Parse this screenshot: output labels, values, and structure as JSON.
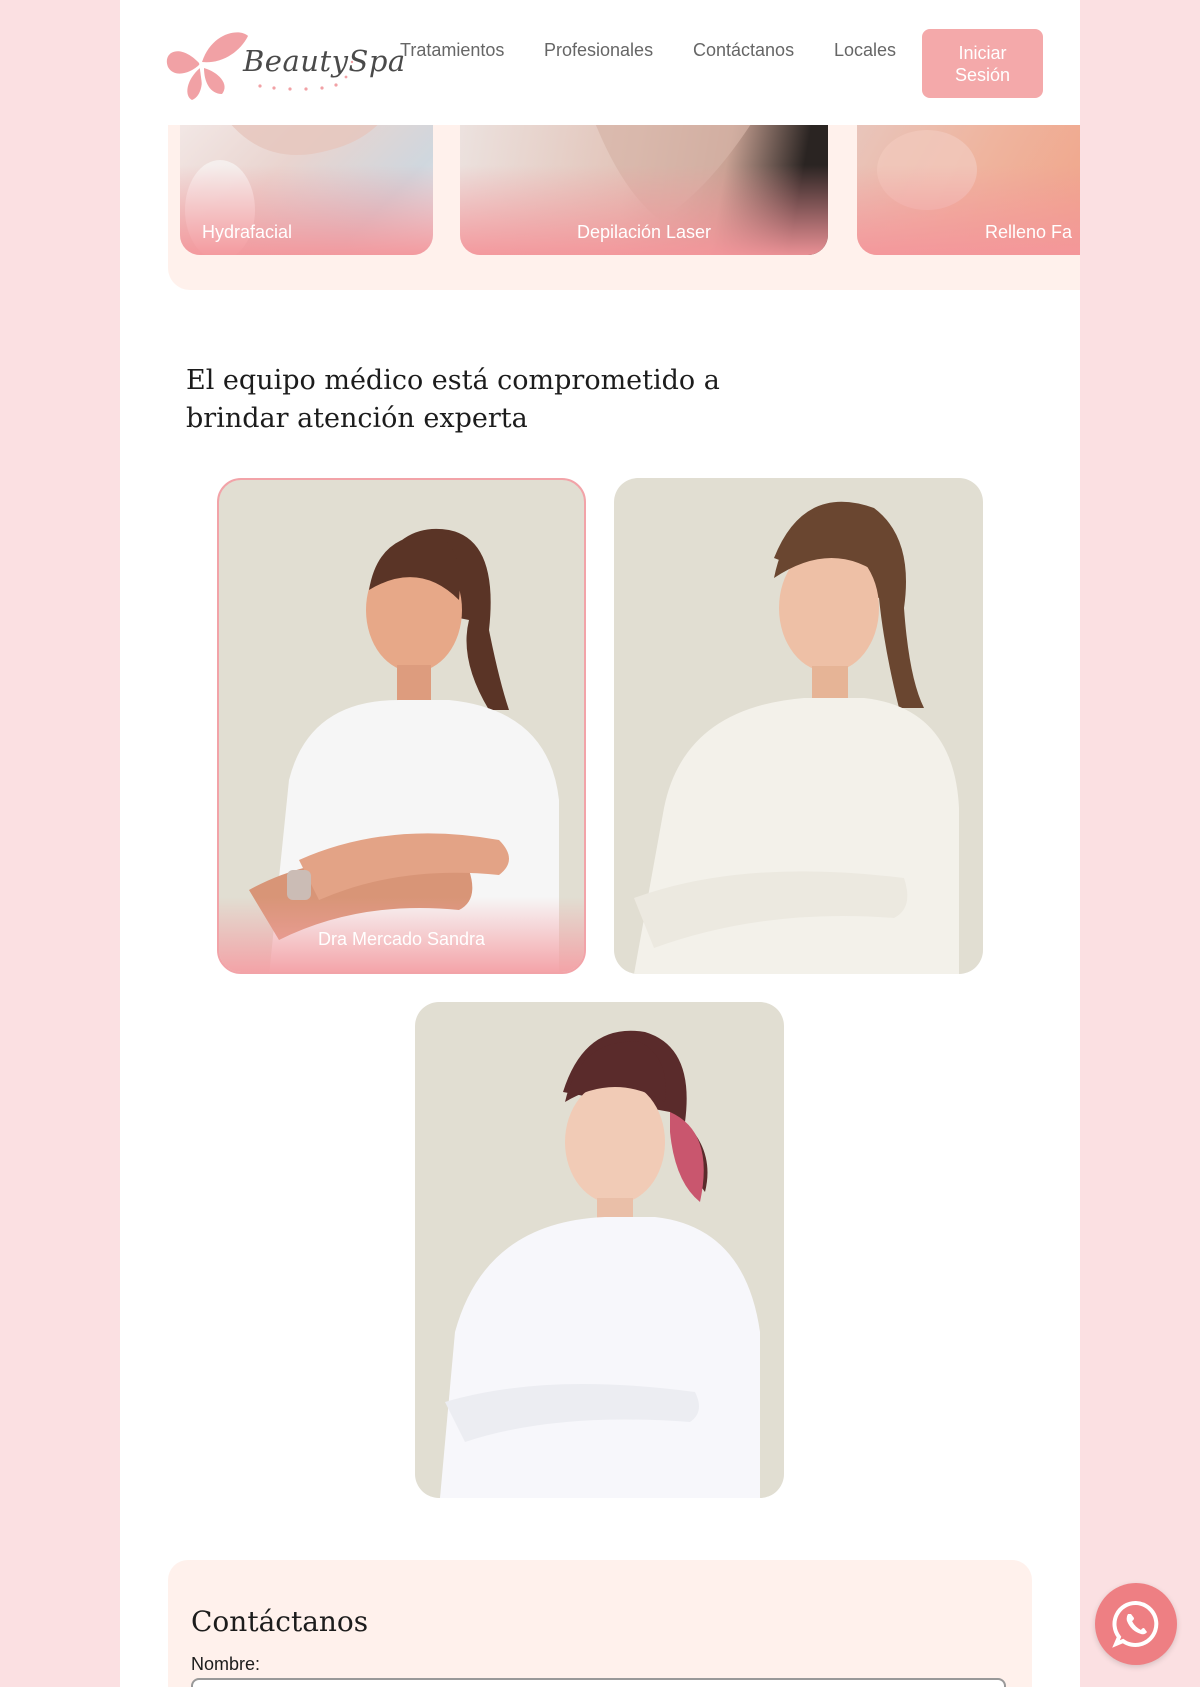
{
  "brand": {
    "logo_text": "BeautySpa"
  },
  "nav": {
    "items": [
      {
        "label": "Tratamientos"
      },
      {
        "label": "Profesionales"
      },
      {
        "label": "Contáctanos"
      },
      {
        "label": "Locales"
      }
    ],
    "login_label": "Iniciar Sesión"
  },
  "treatments": [
    {
      "label": "Hydrafacial"
    },
    {
      "label": "Depilación Laser"
    },
    {
      "label": "Relleno Fa"
    }
  ],
  "team": {
    "title": "El equipo médico está comprometido a brindar atención experta",
    "professionals": [
      {
        "name": "Dra Mercado Sandra",
        "active": true
      },
      {
        "name": "",
        "active": false
      },
      {
        "name": "",
        "active": false
      }
    ]
  },
  "contact": {
    "title": "Contáctanos",
    "name_label": "Nombre:"
  },
  "colors": {
    "accent": "#f4a9aa",
    "background": "#fbe0e2",
    "panel": "#fff1ec",
    "whatsapp": "#ee7f83"
  },
  "icons": [
    "butterfly-logo-icon",
    "whatsapp-icon"
  ]
}
